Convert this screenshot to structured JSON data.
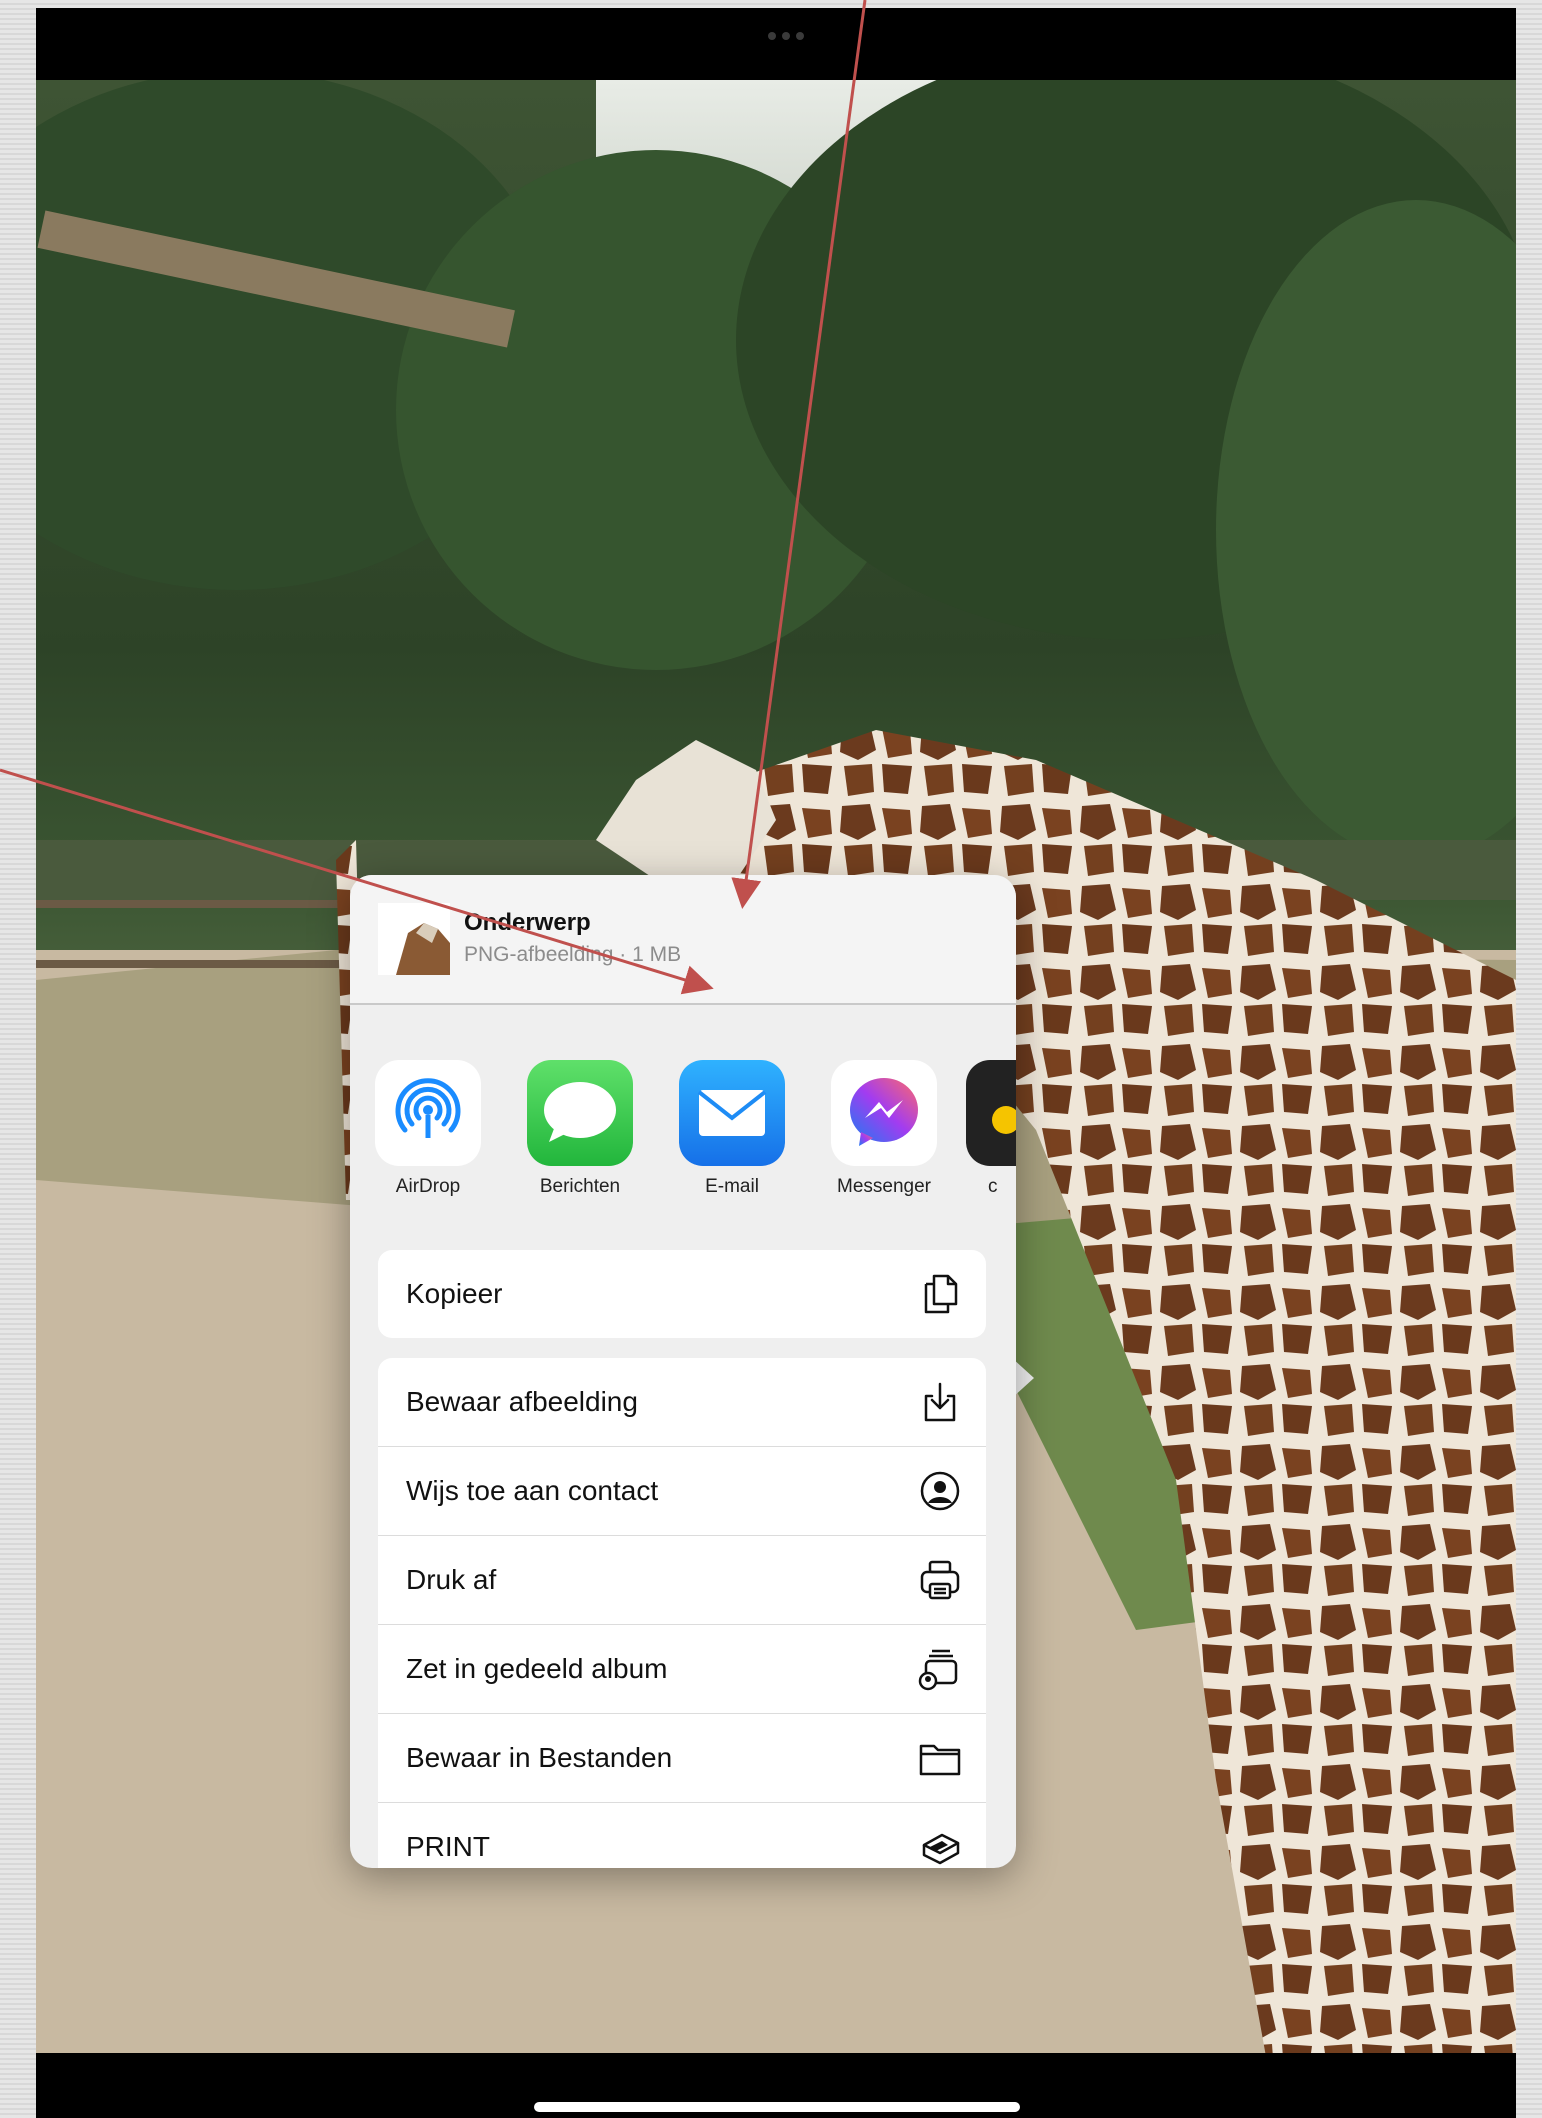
{
  "share_sheet": {
    "header": {
      "title": "Onderwerp",
      "subtitle": "PNG-afbeelding · 1 MB"
    },
    "apps": [
      {
        "label": "AirDrop",
        "icon": "airdrop-icon",
        "color": "#1a8cff"
      },
      {
        "label": "Berichten",
        "icon": "messages-icon",
        "color": "#34c759"
      },
      {
        "label": "E-mail",
        "icon": "mail-icon",
        "color": "#1e8cf5"
      },
      {
        "label": "Messenger",
        "icon": "messenger-icon",
        "color": "#a23cf0"
      },
      {
        "label": "c",
        "icon": "app-icon-partial",
        "color": "#222222"
      }
    ],
    "actions_primary": [
      {
        "label": "Kopieer",
        "icon": "copy-icon"
      }
    ],
    "actions_secondary": [
      {
        "label": "Bewaar afbeelding",
        "icon": "save-image-icon"
      },
      {
        "label": "Wijs toe aan contact",
        "icon": "contact-icon"
      },
      {
        "label": "Druk af",
        "icon": "print-icon"
      },
      {
        "label": "Zet in gedeeld album",
        "icon": "shared-album-icon"
      },
      {
        "label": "Bewaar in Bestanden",
        "icon": "folder-icon"
      },
      {
        "label": "PRINT",
        "icon": "print-service-icon"
      }
    ]
  },
  "annotation_color": "#c0504d"
}
